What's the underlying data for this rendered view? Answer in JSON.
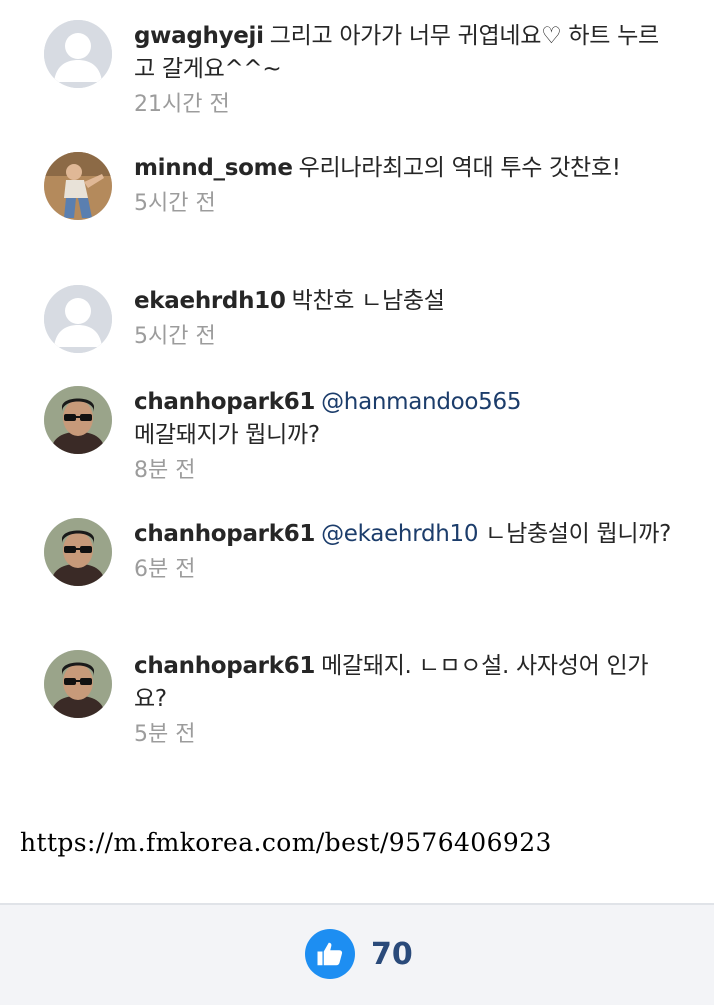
{
  "comments": [
    {
      "username": "gwaghyeji",
      "text": "그리고 아가가 너무 귀엽네요♡ 하트 누르고 갈게요^^~",
      "time": "21시간 전",
      "avatar": "default-avatar"
    },
    {
      "username": "minnd_some",
      "text": "우리나라최고의 역대 투수 갓찬호!",
      "time": "5시간 전",
      "avatar": "photo-avatar"
    },
    {
      "username": "ekaehrdh10",
      "text": "박찬호 ㄴ남충설",
      "time": "5시간 전",
      "avatar": "default-avatar"
    },
    {
      "username": "chanhopark61",
      "mention": "@hanmandoo565",
      "text": "메갈돼지가 뭡니까?",
      "time": "8분 전",
      "avatar": "sunglasses-avatar"
    },
    {
      "username": "chanhopark61",
      "mention": "@ekaehrdh10",
      "text": "ㄴ남충설이 뭡니까?",
      "time": "6분 전",
      "avatar": "sunglasses-avatar"
    },
    {
      "username": "chanhopark61",
      "text": "메갈돼지. ㄴㅁㅇ설. 사자성어 인가요?",
      "time": "5분 전",
      "avatar": "sunglasses-avatar"
    }
  ],
  "source_url": "https://m.fmkorea.com/best/9576406923",
  "footer": {
    "like_icon": "thumbs-up-icon",
    "like_count": "70",
    "accent_color": "#1d8ef2"
  }
}
